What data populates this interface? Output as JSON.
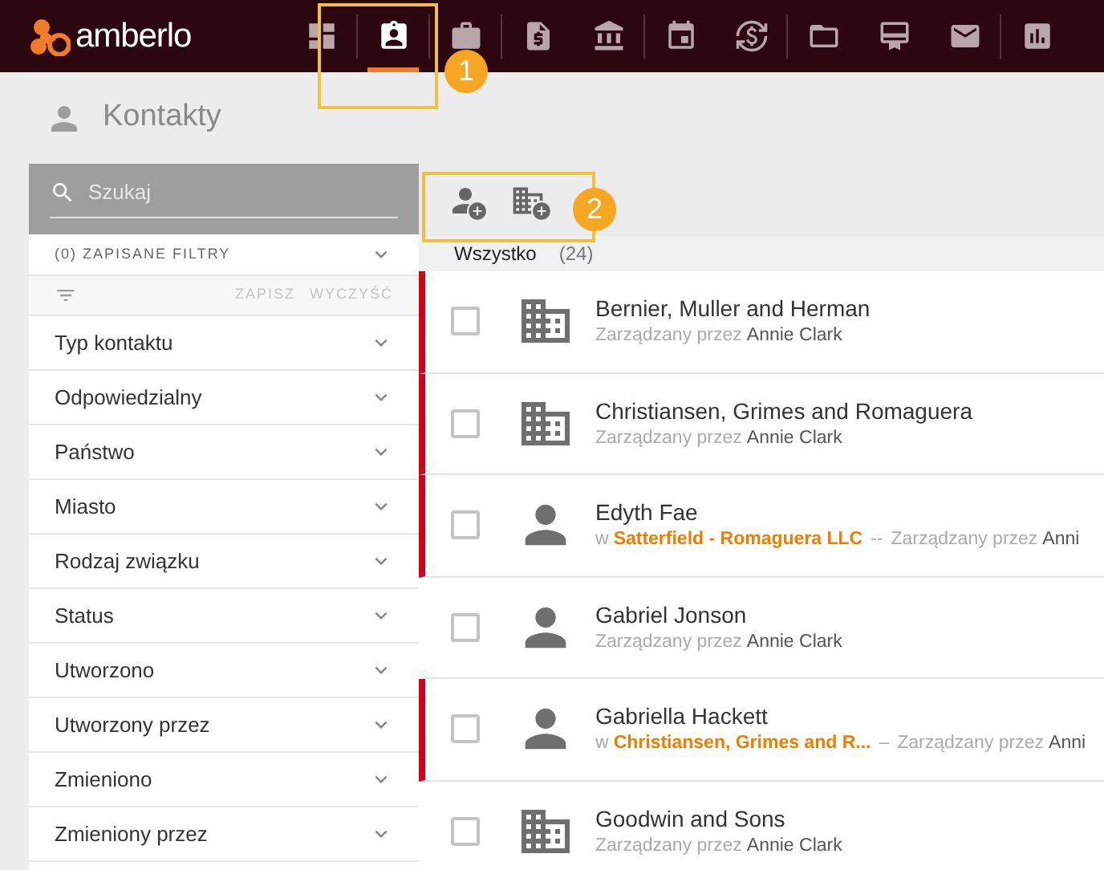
{
  "app": {
    "logo_text": "amberlo"
  },
  "nav": [
    {
      "kind": "dashboard",
      "selected": false,
      "divider_before": false
    },
    {
      "kind": "contacts",
      "selected": true,
      "divider_before": true
    },
    {
      "kind": "briefcase",
      "selected": false,
      "divider_before": true
    },
    {
      "kind": "invoice",
      "selected": false,
      "divider_before": true
    },
    {
      "kind": "bank",
      "selected": false,
      "divider_before": false
    },
    {
      "kind": "calendar",
      "selected": false,
      "divider_before": true
    },
    {
      "kind": "time",
      "selected": false,
      "divider_before": false
    },
    {
      "kind": "folder",
      "selected": false,
      "divider_before": true
    },
    {
      "kind": "certificate",
      "selected": false,
      "divider_before": false
    },
    {
      "kind": "mail",
      "selected": false,
      "divider_before": false
    },
    {
      "kind": "report",
      "selected": false,
      "divider_before": true
    }
  ],
  "page": {
    "title": "Kontakty"
  },
  "callouts": [
    {
      "label": "1"
    },
    {
      "label": "2"
    }
  ],
  "sidebar": {
    "search": {
      "placeholder": "Szukaj"
    },
    "saved_filters": "(0) ZAPISANE FILTRY",
    "save": "ZAPISZ",
    "clear": "WYCZYŚĆ",
    "filters": [
      "Typ kontaktu",
      "Odpowiedzialny",
      "Państwo",
      "Miasto",
      "Rodzaj związku",
      "Status",
      "Utworzono",
      "Utworzony przez",
      "Zmieniono",
      "Zmieniony przez"
    ]
  },
  "tabs": [
    {
      "label": "Wszystko",
      "count": "(24)",
      "selected": true
    }
  ],
  "contacts": [
    {
      "kind": "company",
      "name": "Bernier, Muller and Herman",
      "flagged": true,
      "checked": false,
      "manager_label": "Zarządzany przez",
      "manager": "Annie Clark"
    },
    {
      "kind": "company",
      "name": "Christiansen, Grimes and Romaguera",
      "flagged": true,
      "checked": false,
      "manager_label": "Zarządzany przez",
      "manager": "Annie Clark"
    },
    {
      "kind": "person",
      "name": "Edyth Fae",
      "flagged": true,
      "checked": false,
      "prefix": "w",
      "company": "Satterfield - Romaguera LLC",
      "separator": "--",
      "manager_label": "Zarządzany przez",
      "manager": "Anni"
    },
    {
      "kind": "person",
      "name": "Gabriel Jonson",
      "flagged": false,
      "checked": false,
      "manager_label": "Zarządzany przez",
      "manager": "Annie Clark"
    },
    {
      "kind": "person",
      "name": "Gabriella Hackett",
      "flagged": true,
      "checked": false,
      "prefix": "w",
      "company": "Christiansen, Grimes and R...",
      "separator": "–",
      "manager_label": "Zarządzany przez",
      "manager": "Anni"
    },
    {
      "kind": "company",
      "name": "Goodwin and Sons",
      "flagged": false,
      "checked": false,
      "manager_label": "Zarządzany przez",
      "manager": "Annie Clark"
    }
  ]
}
